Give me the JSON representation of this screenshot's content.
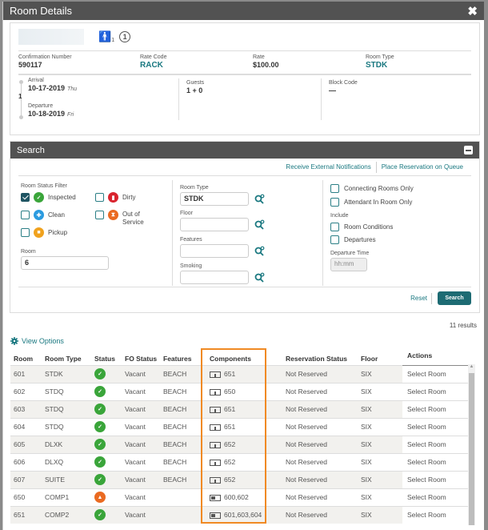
{
  "dialog": {
    "title": "Room Details",
    "close_icon": "close-icon"
  },
  "reservation": {
    "guest_count_icon": "person-icon",
    "guest_count": "1",
    "queue_number": "1",
    "confirmation_label": "Confirmation Number",
    "confirmation_value": "590117",
    "rate_code_label": "Rate Code",
    "rate_code_value": "RACK",
    "rate_label": "Rate",
    "rate_value": "$100.00",
    "room_type_label": "Room Type",
    "room_type_value": "STDK",
    "arrival_label": "Arrival",
    "arrival_date": "10-17-2019",
    "arrival_day": "Thu",
    "nights": "1",
    "departure_label": "Departure",
    "departure_date": "10-18-2019",
    "departure_day": "Fri",
    "guests_label": "Guests",
    "guests_value": "1 + 0",
    "block_code_label": "Block Code",
    "block_code_value": "—"
  },
  "search": {
    "title": "Search",
    "link_external": "Receive External Notifications",
    "link_queue": "Place Reservation on Queue",
    "room_status_filter_label": "Room Status Filter",
    "statuses": [
      {
        "label": "Inspected",
        "checked": true,
        "color": "#3aa53a"
      },
      {
        "label": "Dirty",
        "checked": false,
        "color": "#d9232e"
      },
      {
        "label": "Clean",
        "checked": false,
        "color": "#2b9be0"
      },
      {
        "label": "Out of Service",
        "checked": false,
        "color": "#ea6a21"
      },
      {
        "label": "Pickup",
        "checked": false,
        "color": "#f0a21e"
      }
    ],
    "room_label": "Room",
    "room_value": "6",
    "room_type_label": "Room Type",
    "room_type_value": "STDK",
    "floor_label": "Floor",
    "floor_value": "",
    "features_label": "Features",
    "features_value": "",
    "smoking_label": "Smoking",
    "smoking_value": "",
    "connecting_rooms_label": "Connecting Rooms Only",
    "attendant_label": "Attendant In Room Only",
    "include_label": "Include",
    "room_conditions_label": "Room Conditions",
    "departures_label": "Departures",
    "departure_time_label": "Departure Time",
    "departure_time_placeholder": "hh:mm",
    "reset_label": "Reset",
    "search_label": "Search"
  },
  "results": {
    "count_text": "11 results",
    "view_options_label": "View Options",
    "columns": [
      "Room",
      "Room Type",
      "Status",
      "FO Status",
      "Features",
      "Components",
      "Reservation Status",
      "Floor",
      "Actions"
    ],
    "rows": [
      {
        "room": "601",
        "room_type": "STDK",
        "status": "inspected",
        "fo_status": "Vacant",
        "features": "BEACH",
        "component_type": "room",
        "components": "651",
        "reservation_status": "Not Reserved",
        "floor": "SIX",
        "action": "Select Room"
      },
      {
        "room": "602",
        "room_type": "STDQ",
        "status": "inspected",
        "fo_status": "Vacant",
        "features": "BEACH",
        "component_type": "room",
        "components": "650",
        "reservation_status": "Not Reserved",
        "floor": "SIX",
        "action": "Select Room"
      },
      {
        "room": "603",
        "room_type": "STDQ",
        "status": "inspected",
        "fo_status": "Vacant",
        "features": "BEACH",
        "component_type": "room",
        "components": "651",
        "reservation_status": "Not Reserved",
        "floor": "SIX",
        "action": "Select Room"
      },
      {
        "room": "604",
        "room_type": "STDQ",
        "status": "inspected",
        "fo_status": "Vacant",
        "features": "BEACH",
        "component_type": "room",
        "components": "651",
        "reservation_status": "Not Reserved",
        "floor": "SIX",
        "action": "Select Room"
      },
      {
        "room": "605",
        "room_type": "DLXK",
        "status": "inspected",
        "fo_status": "Vacant",
        "features": "BEACH",
        "component_type": "room",
        "components": "652",
        "reservation_status": "Not Reserved",
        "floor": "SIX",
        "action": "Select Room"
      },
      {
        "room": "606",
        "room_type": "DLXQ",
        "status": "inspected",
        "fo_status": "Vacant",
        "features": "BEACH",
        "component_type": "room",
        "components": "652",
        "reservation_status": "Not Reserved",
        "floor": "SIX",
        "action": "Select Room"
      },
      {
        "room": "607",
        "room_type": "SUITE",
        "status": "inspected",
        "fo_status": "Vacant",
        "features": "BEACH",
        "component_type": "room",
        "components": "652",
        "reservation_status": "Not Reserved",
        "floor": "SIX",
        "action": "Select Room"
      },
      {
        "room": "650",
        "room_type": "COMP1",
        "status": "out-of-service",
        "fo_status": "Vacant",
        "features": "",
        "component_type": "multi",
        "components": "600,602",
        "reservation_status": "Not Reserved",
        "floor": "SIX",
        "action": "Select Room"
      },
      {
        "room": "651",
        "room_type": "COMP2",
        "status": "inspected",
        "fo_status": "Vacant",
        "features": "",
        "component_type": "multi",
        "components": "601,603,604",
        "reservation_status": "Not Reserved",
        "floor": "SIX",
        "action": "Select Room"
      }
    ],
    "status_colors": {
      "inspected": "#3aa53a",
      "out-of-service": "#ea6a21"
    },
    "highlight_color": "#f08a24"
  }
}
